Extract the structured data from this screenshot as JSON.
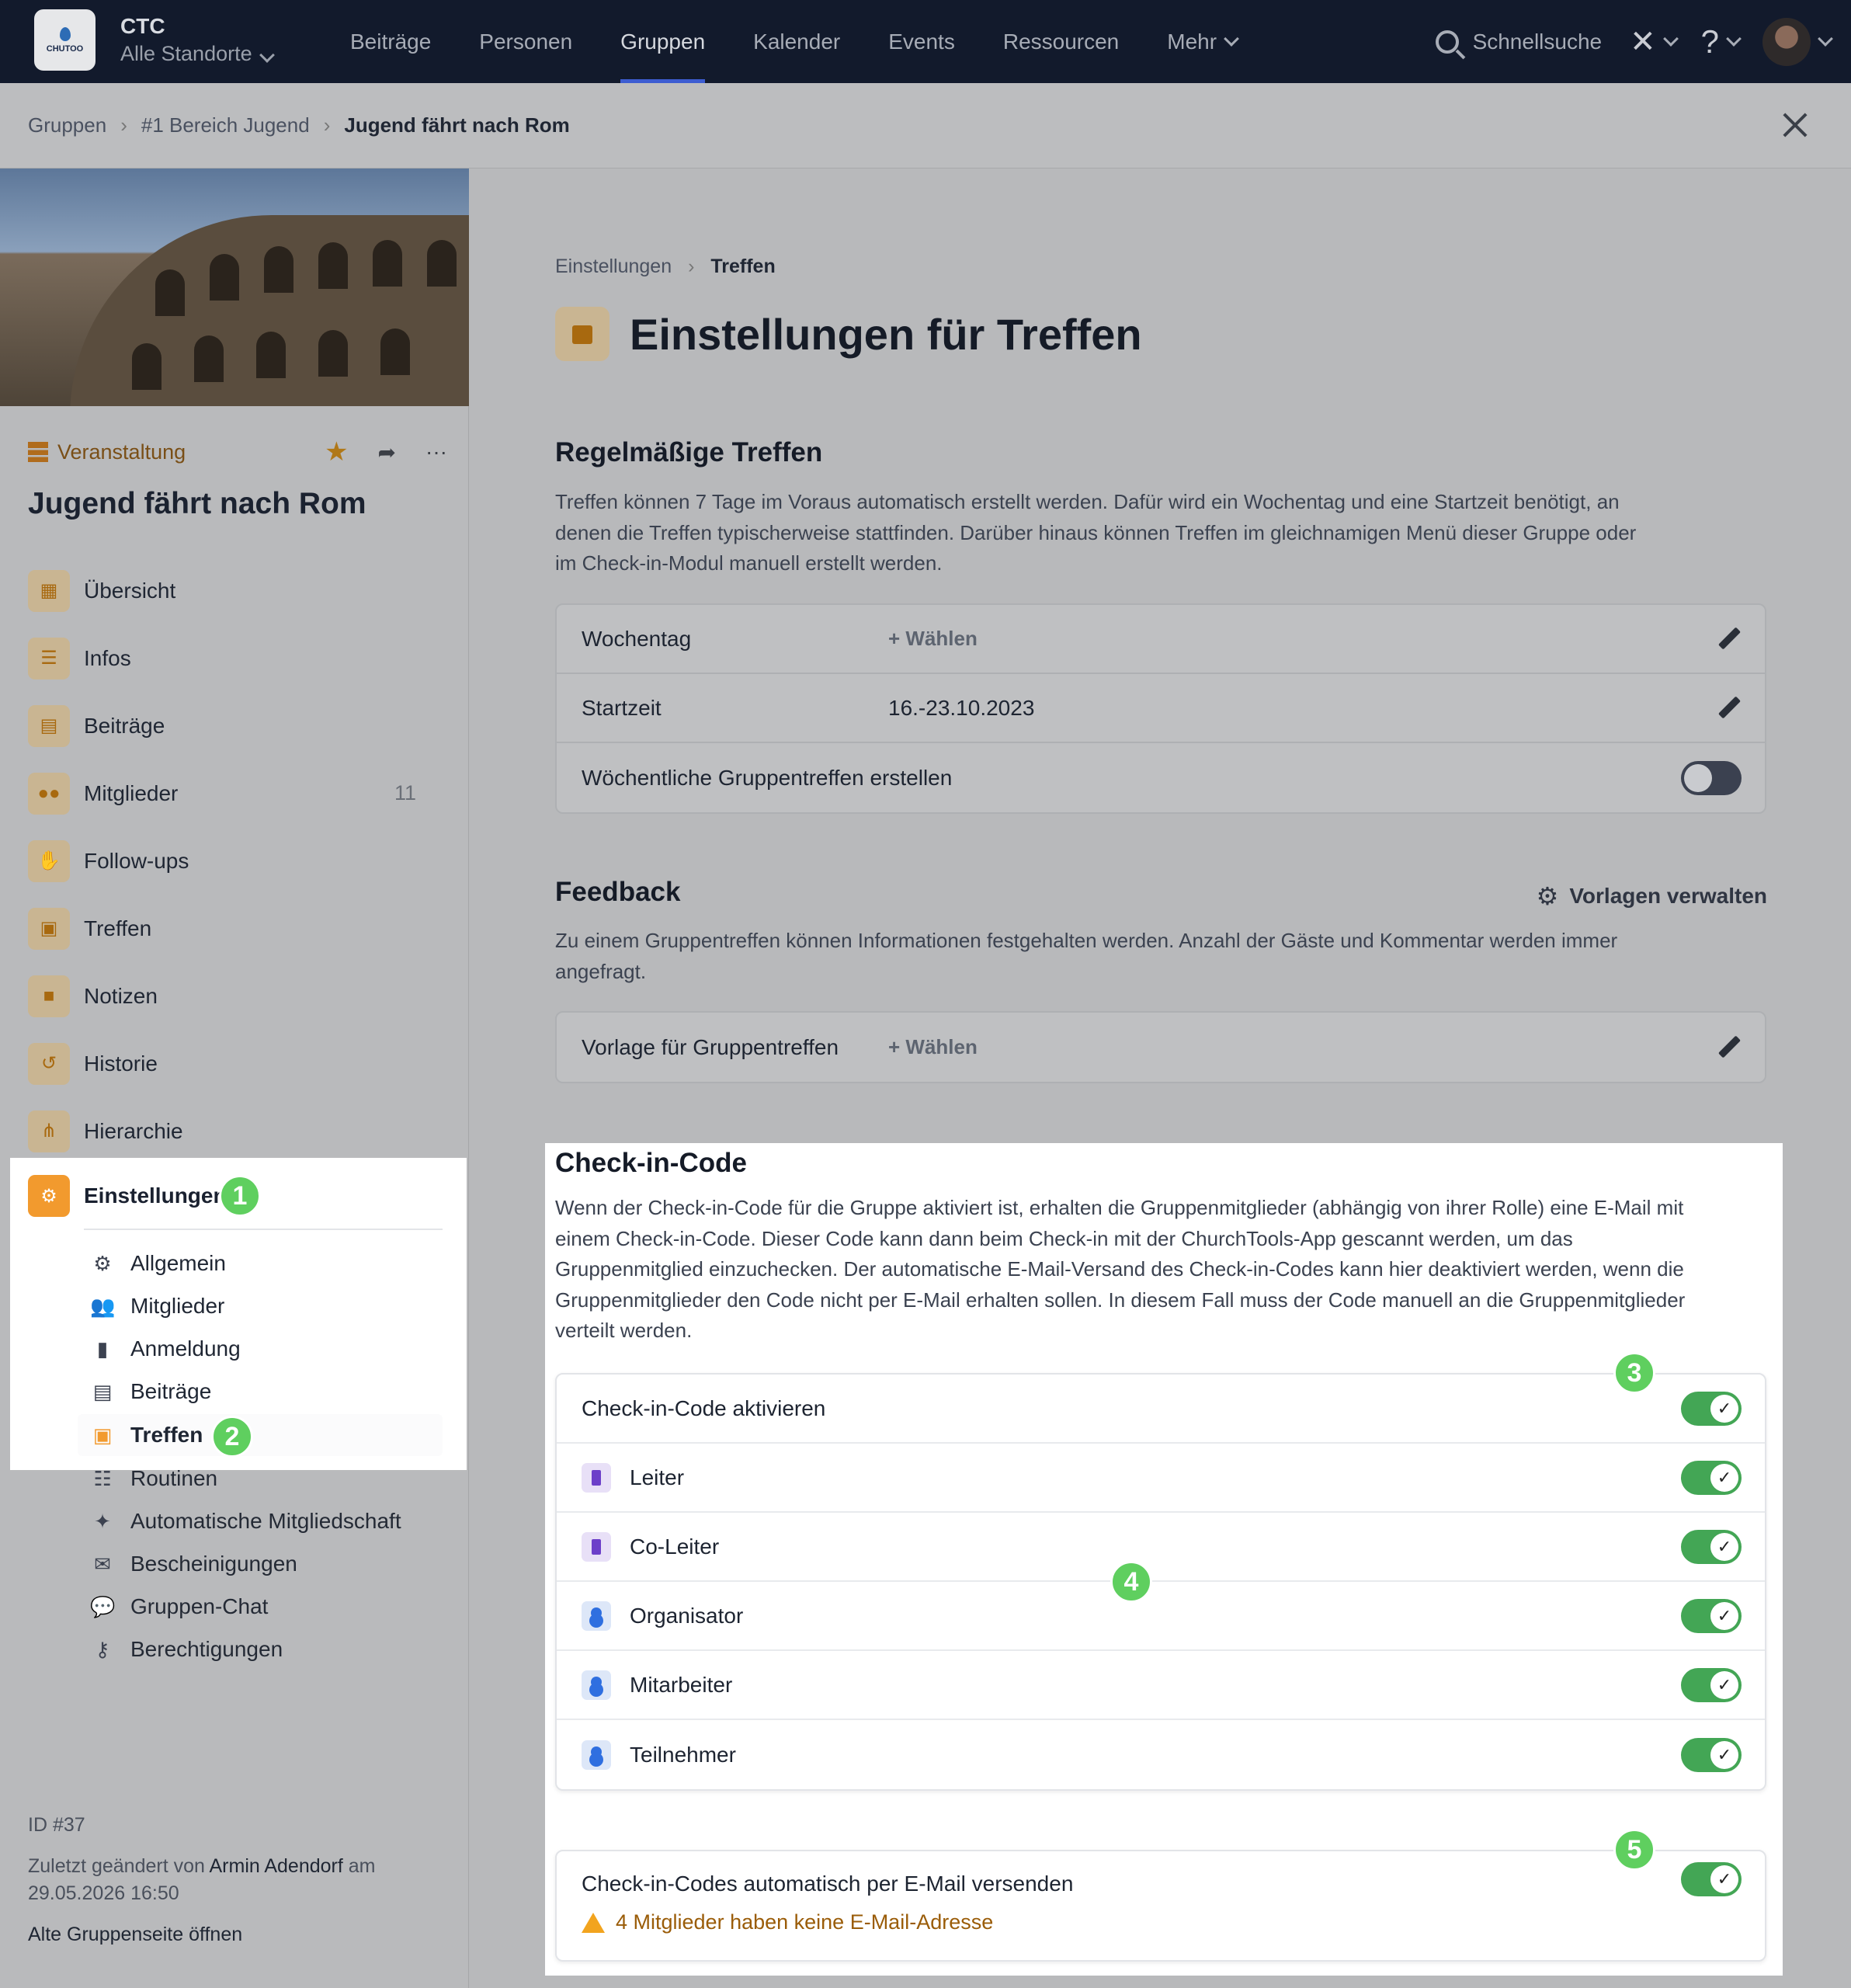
{
  "topnav": {
    "logo_text": "CHUTOO",
    "site_name": "CTC",
    "site_sub": "Alle Standorte",
    "items": [
      "Beiträge",
      "Personen",
      "Gruppen",
      "Kalender",
      "Events",
      "Ressourcen",
      "Mehr"
    ],
    "active": "Gruppen",
    "search_placeholder": "Schnellsuche",
    "help": "?"
  },
  "breadcrumb": {
    "items": [
      "Gruppen",
      "#1 Bereich Jugend",
      "Jugend fährt nach Rom"
    ]
  },
  "sidebar": {
    "type_label": "Veranstaltung",
    "group_title": "Jugend fährt nach Rom",
    "menu": [
      {
        "label": "Übersicht",
        "icon": "grid-icon"
      },
      {
        "label": "Infos",
        "icon": "list-icon"
      },
      {
        "label": "Beiträge",
        "icon": "newspaper-icon"
      },
      {
        "label": "Mitglieder",
        "icon": "users-icon",
        "count": "11"
      },
      {
        "label": "Follow-ups",
        "icon": "handshake-icon"
      },
      {
        "label": "Treffen",
        "icon": "calendar-icon"
      },
      {
        "label": "Notizen",
        "icon": "note-icon"
      },
      {
        "label": "Historie",
        "icon": "history-icon"
      },
      {
        "label": "Hierarchie",
        "icon": "hierarchy-icon"
      }
    ],
    "settings": {
      "label": "Einstellungen",
      "sub": [
        {
          "label": "Allgemein",
          "icon": "gear-icon"
        },
        {
          "label": "Mitglieder",
          "icon": "users-icon"
        },
        {
          "label": "Anmeldung",
          "icon": "door-icon"
        },
        {
          "label": "Beiträge",
          "icon": "newspaper-icon"
        },
        {
          "label": "Treffen",
          "icon": "calendar-icon",
          "active": true
        },
        {
          "label": "Routinen",
          "icon": "checklist-icon"
        },
        {
          "label": "Automatische Mitgliedschaft",
          "icon": "sparkle-icon"
        },
        {
          "label": "Bescheinigungen",
          "icon": "certificate-icon"
        },
        {
          "label": "Gruppen-Chat",
          "icon": "chat-icon"
        },
        {
          "label": "Berechtigungen",
          "icon": "key-icon"
        }
      ]
    },
    "footer": {
      "id": "ID #37",
      "changed_prefix": "Zuletzt geändert von",
      "changed_by": "Armin Adendorf",
      "changed_on": "am",
      "changed_date": "29.05.2026 16:50",
      "old_page": "Alte Gruppenseite öffnen"
    }
  },
  "badges": [
    "1",
    "2",
    "3",
    "4",
    "5"
  ],
  "main": {
    "crumb": [
      "Einstellungen",
      "Treffen"
    ],
    "title": "Einstellungen für Treffen",
    "regular": {
      "heading": "Regelmäßige Treffen",
      "text": "Treffen können 7 Tage im Voraus automatisch erstellt werden. Dafür wird ein Wochentag und eine Startzeit benötigt, an denen die Treffen typischerweise stattfinden. Darüber hinaus können Treffen im gleichnamigen Menü dieser Gruppe oder im Check-in-Modul manuell erstellt werden.",
      "rows": [
        {
          "label": "Wochentag",
          "value": "+ Wählen"
        },
        {
          "label": "Startzeit",
          "value": "16.-23.10.2023"
        },
        {
          "label": "Wöchentliche Gruppentreffen erstellen",
          "toggle": false
        }
      ]
    },
    "feedback": {
      "heading": "Feedback",
      "manage": "Vorlagen verwalten",
      "text": "Zu einem Gruppentreffen können Informationen festgehalten werden. Anzahl der Gäste und Kommentar werden immer angefragt.",
      "row_label": "Vorlage für Gruppentreffen",
      "row_value": "+ Wählen"
    },
    "checkin": {
      "heading": "Check-in-Code",
      "text": "Wenn der Check-in-Code für die Gruppe aktiviert ist, erhalten die Gruppenmitglieder (abhängig von ihrer Rolle) eine E-Mail mit einem Check-in-Code. Dieser Code kann dann beim Check-in mit der ChurchTools-App gescannt werden, um das Gruppenmitglied einzuchecken. Der automatische E-Mail-Versand des Check-in-Codes kann hier deaktiviert werden, wenn die Gruppenmitglieder den Code nicht per E-Mail erhalten sollen. In diesem Fall muss der Code manuell an die Gruppenmitglieder verteilt werden.",
      "activate_label": "Check-in-Code aktivieren",
      "roles": [
        {
          "label": "Leiter",
          "type": "purple"
        },
        {
          "label": "Co-Leiter",
          "type": "purple"
        },
        {
          "label": "Organisator",
          "type": "blue"
        },
        {
          "label": "Mitarbeiter",
          "type": "blue"
        },
        {
          "label": "Teilnehmer",
          "type": "blue"
        }
      ],
      "email_label": "Check-in-Codes automatisch per E-Mail versenden",
      "warning": "4 Mitglieder haben keine E-Mail-Adresse"
    }
  }
}
